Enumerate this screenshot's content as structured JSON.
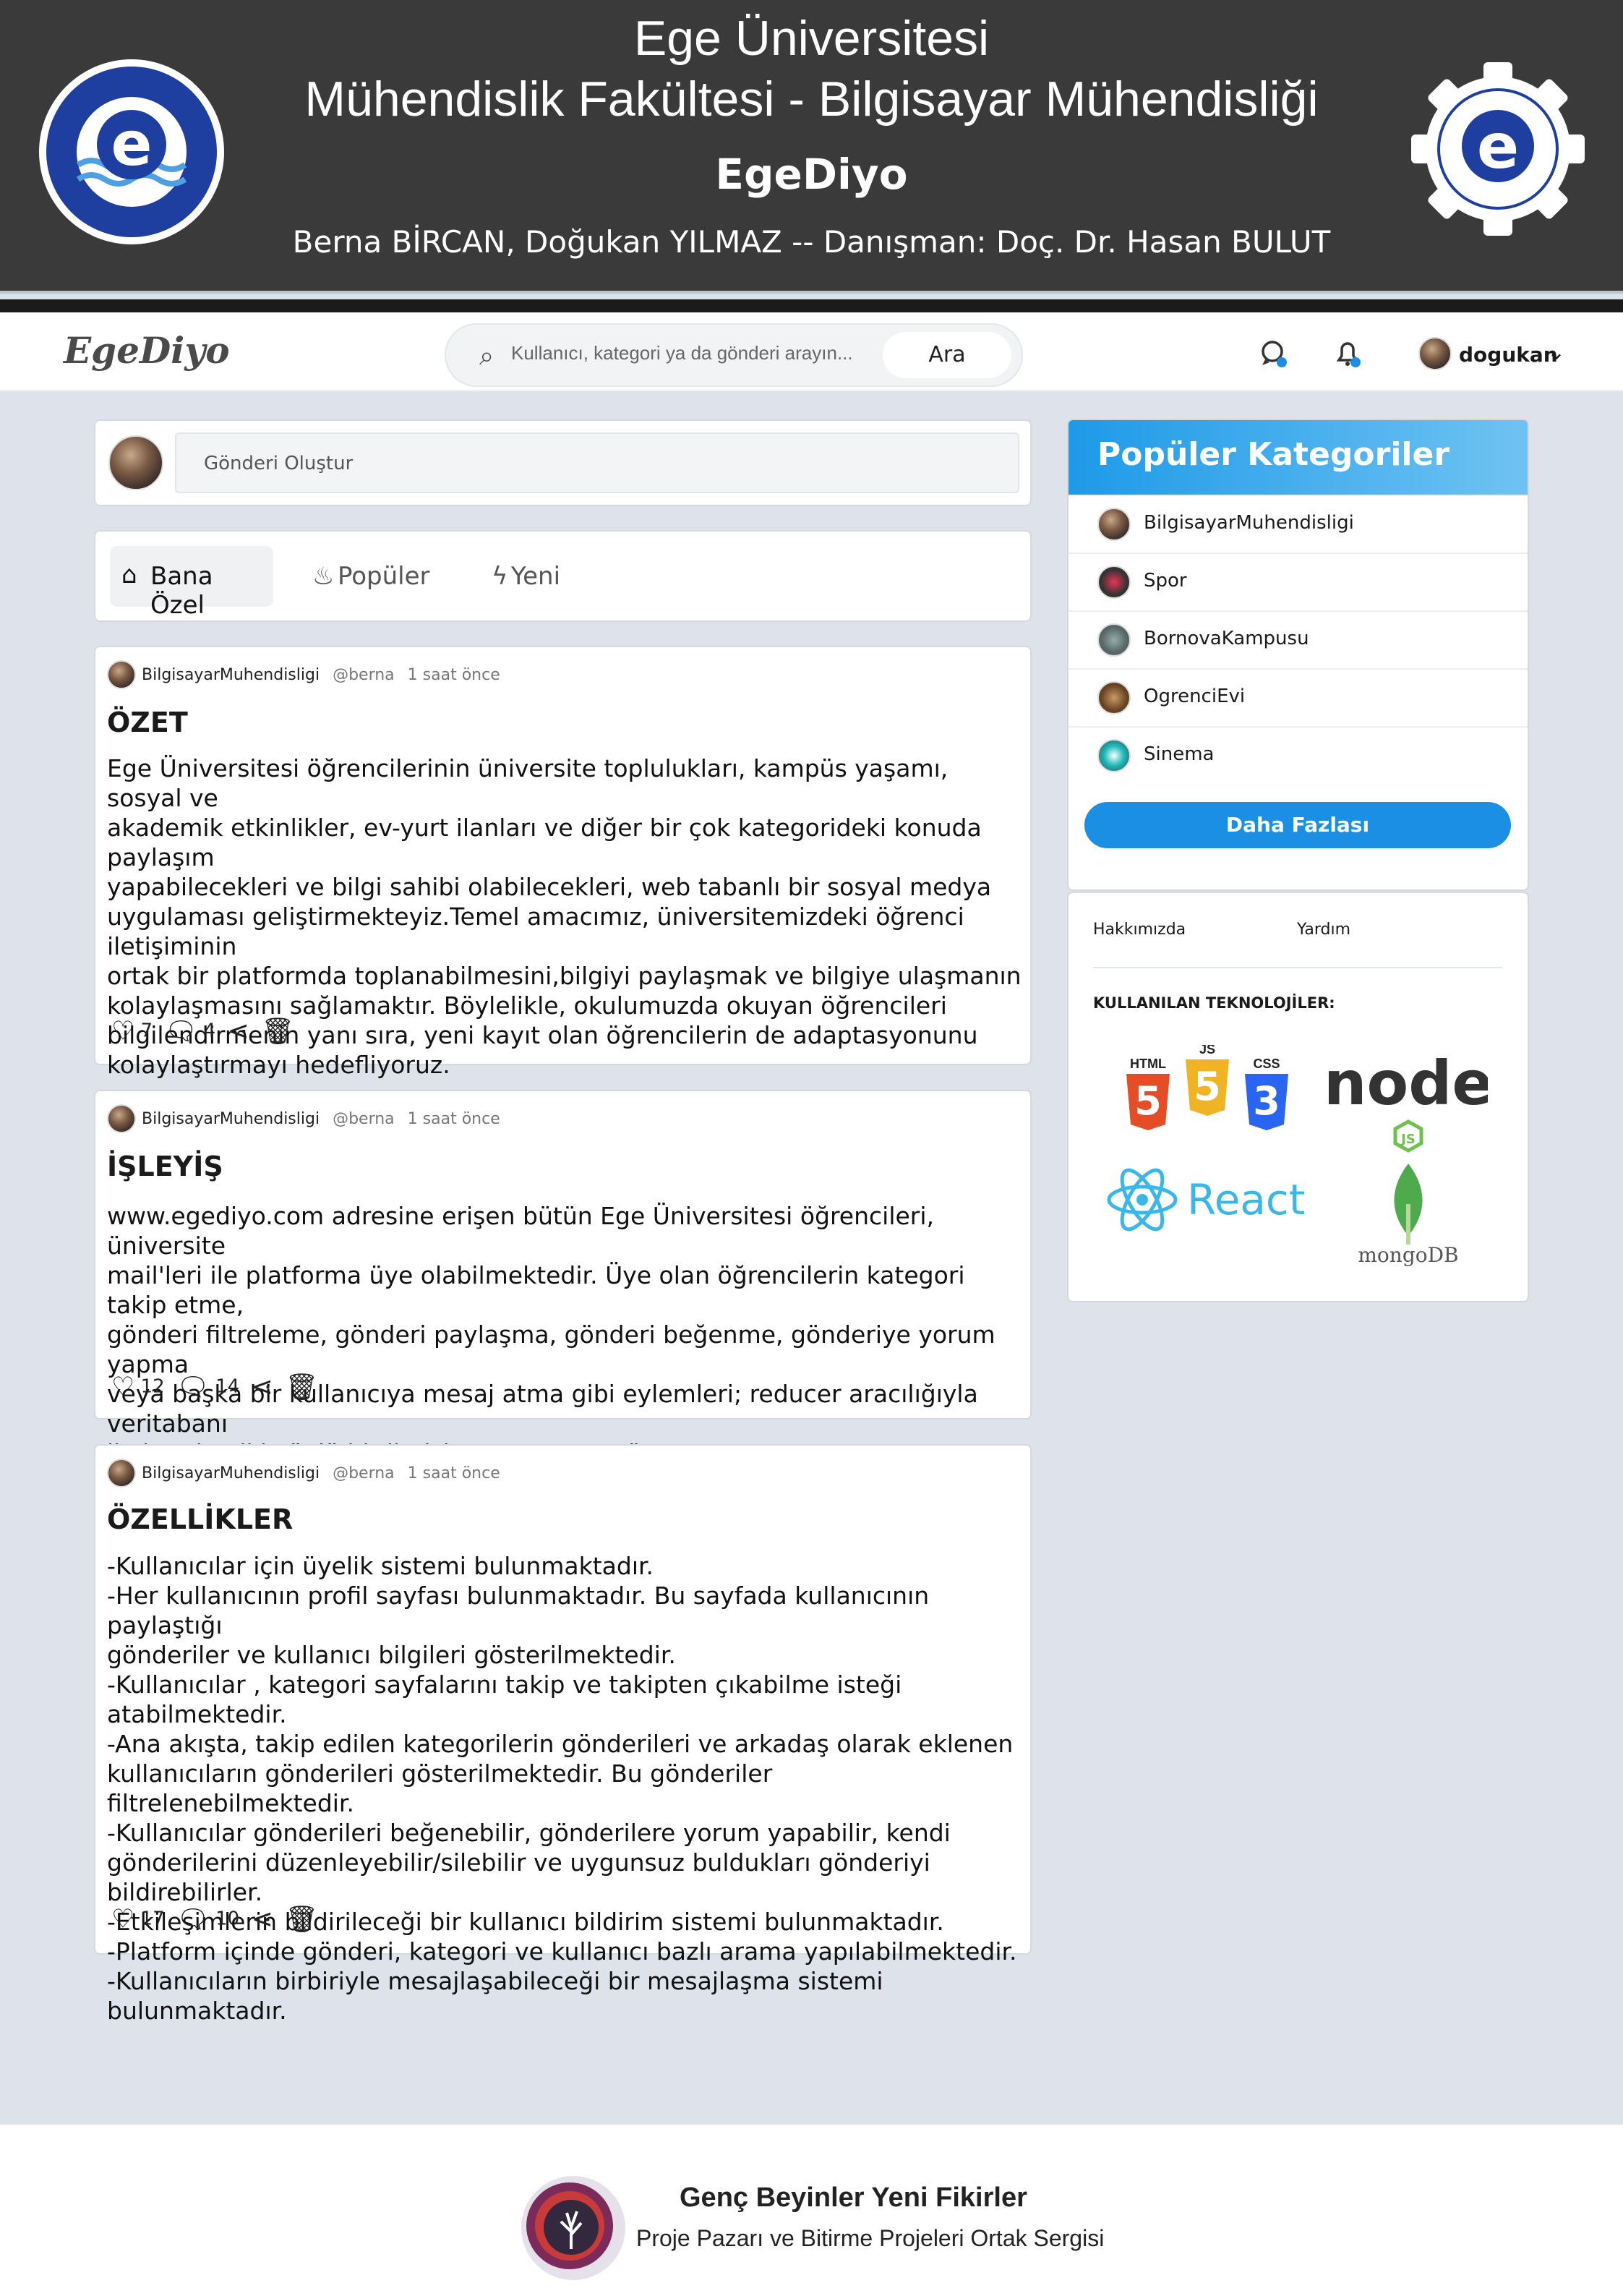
{
  "banner": {
    "university": "Ege Üniversitesi",
    "faculty": "Mühendislik Fakültesi - Bilgisayar Mühendisliği",
    "project": "EgeDiyo",
    "authors": "Berna BİRCAN, Doğukan YILMAZ  --   Danışman: Doç. Dr. Hasan BULUT",
    "left_seal": "EGE ÜNİVERSİTESİ 1955",
    "right_seal": "EGE ÜNİVERSİTESİ MÜHENDİSLİK FAKÜLTESİ 1982"
  },
  "nav": {
    "logo": "EgeDiyo",
    "search_placeholder": "Kullanıcı, kategori ya da gönderi arayın...",
    "search_button": "Ara",
    "username": "dogukan"
  },
  "composer": {
    "placeholder": "Gönderi Oluştur"
  },
  "tabs": [
    {
      "label": "Bana Özel",
      "icon": "home-icon"
    },
    {
      "label": "Popüler",
      "icon": "flame-icon"
    },
    {
      "label": "Yeni",
      "icon": "bolt-icon"
    }
  ],
  "posts": [
    {
      "category": "BilgisayarMuhendisligi",
      "user": "@berna",
      "time": "1 saat önce",
      "title": "ÖZET",
      "body": "Ege Üniversitesi öğrencilerinin üniversite toplulukları, kampüs yaşamı, sosyal ve\nakademik etkinlikler, ev-yurt ilanları ve diğer bir çok kategorideki konuda paylaşım\nyapabilecekleri ve bilgi sahibi olabilecekleri, web tabanlı bir sosyal medya\nuygulaması geliştirmekteyiz.Temel amacımız, üniversitemizdeki öğrenci iletişiminin\nortak bir platformda toplanabilmesini,bilgiyi paylaşmak ve bilgiye ulaşmanın\nkolaylaşmasını sağlamaktır. Böylelikle, okulumuzda okuyan öğrencileri\nbilgilendirmenin yanı sıra, yeni kayıt olan öğrencilerin de adaptasyonunu\nkolaylaştırmayı hedefliyoruz.",
      "likes": "7",
      "comments": "4"
    },
    {
      "category": "BilgisayarMuhendisligi",
      "user": "@berna",
      "time": "1 saat önce",
      "title": "İŞLEYİŞ",
      "body": "www.egediyo.com adresine erişen bütün Ege Üniversitesi öğrencileri, üniversite\nmail'leri ile platforma üye olabilmektedir. Üye olan öğrencilerin kategori takip etme,\ngönderi filtreleme, gönderi paylaşma, gönderi beğenme, gönderiye yorum yapma\nveya başka bir kullanıcıya mesaj atma gibi eylemleri; reducer aracılığıyla veritabanı\nile kurulan iki yönlü bir iletişim sonucu arayüze yansır.",
      "likes": "12",
      "comments": "14"
    },
    {
      "category": "BilgisayarMuhendisligi",
      "user": "@berna",
      "time": "1 saat önce",
      "title": "ÖZELLİKLER",
      "body": "-Kullanıcılar için üyelik sistemi bulunmaktadır.\n-Her kullanıcının profil sayfası bulunmaktadır. Bu sayfada kullanıcının paylaştığı\ngönderiler ve kullanıcı bilgileri gösterilmektedir.\n-Kullanıcılar , kategori sayfalarını takip ve takipten çıkabilme isteği atabilmektedir.\n-Ana akışta, takip edilen kategorilerin gönderileri ve arkadaş olarak eklenen\nkullanıcıların gönderileri gösterilmektedir. Bu gönderiler filtrelenebilmektedir.\n-Kullanıcılar gönderileri beğenebilir, gönderilere yorum yapabilir, kendi\ngönderilerini düzenleyebilir/silebilir ve uygunsuz buldukları gönderiyi bildirebilirler.\n-Etkileşimlerin bildirileceği bir kullanıcı bildirim sistemi bulunmaktadır.\n-Platform içinde gönderi, kategori ve kullanıcı bazlı arama yapılabilmektedir.\n-Kullanıcıların birbiriyle mesajlaşabileceği bir mesajlaşma sistemi bulunmaktadır.",
      "likes": "17",
      "comments": "10"
    }
  ],
  "sidebar": {
    "title": "Popüler Kategoriler",
    "categories": [
      "BilgisayarMuhendisligi",
      "Spor",
      "BornovaKampusu",
      "OgrenciEvi",
      "Sinema"
    ],
    "more_button": "Daha Fazlası",
    "links": [
      "Hakkımızda",
      "Yardım"
    ],
    "tech_heading": "KULLANILAN TEKNOLOJİLER:",
    "tech": {
      "html": "HTML",
      "js": "JS",
      "css": "CSS",
      "node": "node",
      "react": "React",
      "mongo": "mongoDB"
    }
  },
  "footer": {
    "title": "Genç Beyinler Yeni Fikirler",
    "subtitle": "Proje Pazarı ve Bitirme Projeleri Ortak Sergisi"
  },
  "colors": {
    "banner": "#3a3a3a",
    "accent": "#1a8fe3",
    "sidebar_header": "#1e9ae8",
    "page_bg": "#dee3eb"
  }
}
